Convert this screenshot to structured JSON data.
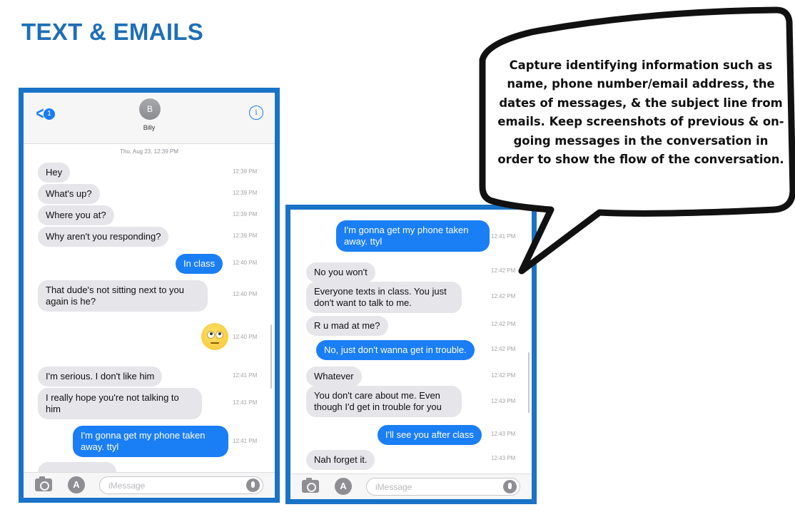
{
  "page_title": "TEXT & EMAILS",
  "callout": {
    "text": "Capture identifying information such as name, phone number/email address, the dates of messages, & the subject line from emails. Keep screenshots of previous & on-going messages in the conversation in order to show the flow of the conversation."
  },
  "phone1": {
    "back_badge": "1",
    "avatar_initial": "B",
    "contact_name": "Billy",
    "date_stamp": "Thu, Aug 23, 12:39 PM",
    "messages": [
      {
        "dir": "recv",
        "text": "Hey",
        "time": "12:39 PM"
      },
      {
        "dir": "recv",
        "text": "What's up?",
        "time": "12:39 PM"
      },
      {
        "dir": "recv",
        "text": "Where you at?",
        "time": "12:39 PM"
      },
      {
        "dir": "recv",
        "text": "Why aren't you responding?",
        "time": "12:39 PM"
      },
      {
        "dir": "sent",
        "text": "In class",
        "time": "12:40 PM"
      },
      {
        "dir": "recv",
        "text": "That dude's not sitting next to you again is he?",
        "time": "12:40 PM"
      },
      {
        "dir": "sent",
        "emoji": "face-with-rolling-eyes",
        "time": "12:40 PM"
      },
      {
        "dir": "recv",
        "text": "I'm serious. I don't like him",
        "time": "12:41 PM"
      },
      {
        "dir": "recv",
        "text": "I really hope you're not talking to him",
        "time": "12:41 PM"
      },
      {
        "dir": "sent",
        "text": "I'm gonna get my phone taken away. ttyl",
        "time": "12:41 PM"
      }
    ],
    "compose_placeholder": "iMessage"
  },
  "phone2": {
    "messages": [
      {
        "dir": "sent",
        "text": "I'm gonna get my phone taken away. ttyl",
        "time": "12:41 PM"
      },
      {
        "dir": "recv",
        "text": "No you won't",
        "time": "12:42 PM"
      },
      {
        "dir": "recv",
        "text": "Everyone texts in class. You just don't want to talk to me.",
        "time": "12:42 PM"
      },
      {
        "dir": "recv",
        "text": "R u mad at me?",
        "time": "12:42 PM"
      },
      {
        "dir": "sent",
        "text": "No, just don't wanna get in trouble.",
        "time": "12:42 PM"
      },
      {
        "dir": "recv",
        "text": "Whatever",
        "time": "12:42 PM"
      },
      {
        "dir": "recv",
        "text": "You don't care about me. Even though I'd get in trouble for you",
        "time": "12:43 PM"
      },
      {
        "dir": "sent",
        "text": "I'll see you after class",
        "time": "12:43 PM"
      },
      {
        "dir": "recv",
        "text": "Nah forget it.",
        "time": "12:43 PM"
      }
    ],
    "compose_placeholder": "iMessage"
  },
  "colors": {
    "title_blue": "#1f6fb7",
    "frame_blue": "#1973c6",
    "sent_bubble": "#1a7ef5",
    "recv_bubble": "#e5e5ea"
  }
}
